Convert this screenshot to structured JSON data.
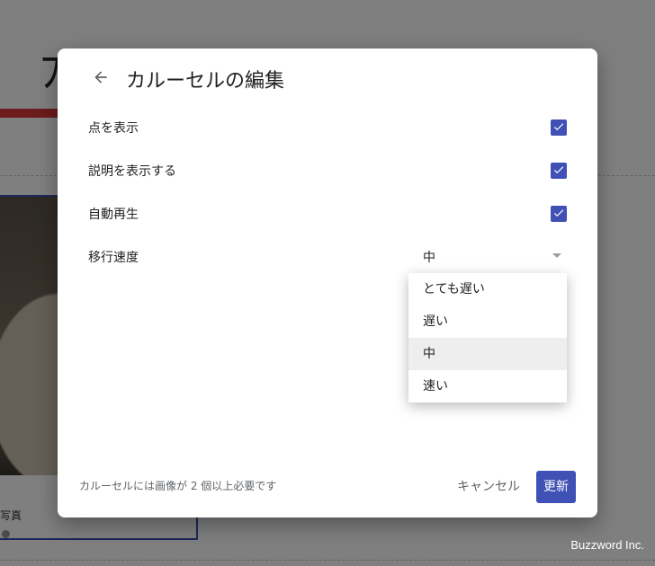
{
  "background": {
    "title_fragment": "ﾌ ﾝ ﾞ",
    "caption": "写真"
  },
  "dialog": {
    "title": "カルーセルの編集",
    "rows": [
      {
        "label": "点を表示",
        "checked": true
      },
      {
        "label": "説明を表示する",
        "checked": true
      },
      {
        "label": "自動再生",
        "checked": true
      }
    ],
    "speed": {
      "label": "移行速度",
      "value": "中",
      "options": [
        "とても遅い",
        "遅い",
        "中",
        "速い"
      ],
      "selected_index": 2
    },
    "footer_note": "カルーセルには画像が 2 個以上必要です",
    "cancel_label": "キャンセル",
    "update_label": "更新"
  },
  "watermark": "Buzzword Inc.",
  "colors": {
    "accent": "#3f51b5",
    "bg_red": "#d9383a"
  }
}
